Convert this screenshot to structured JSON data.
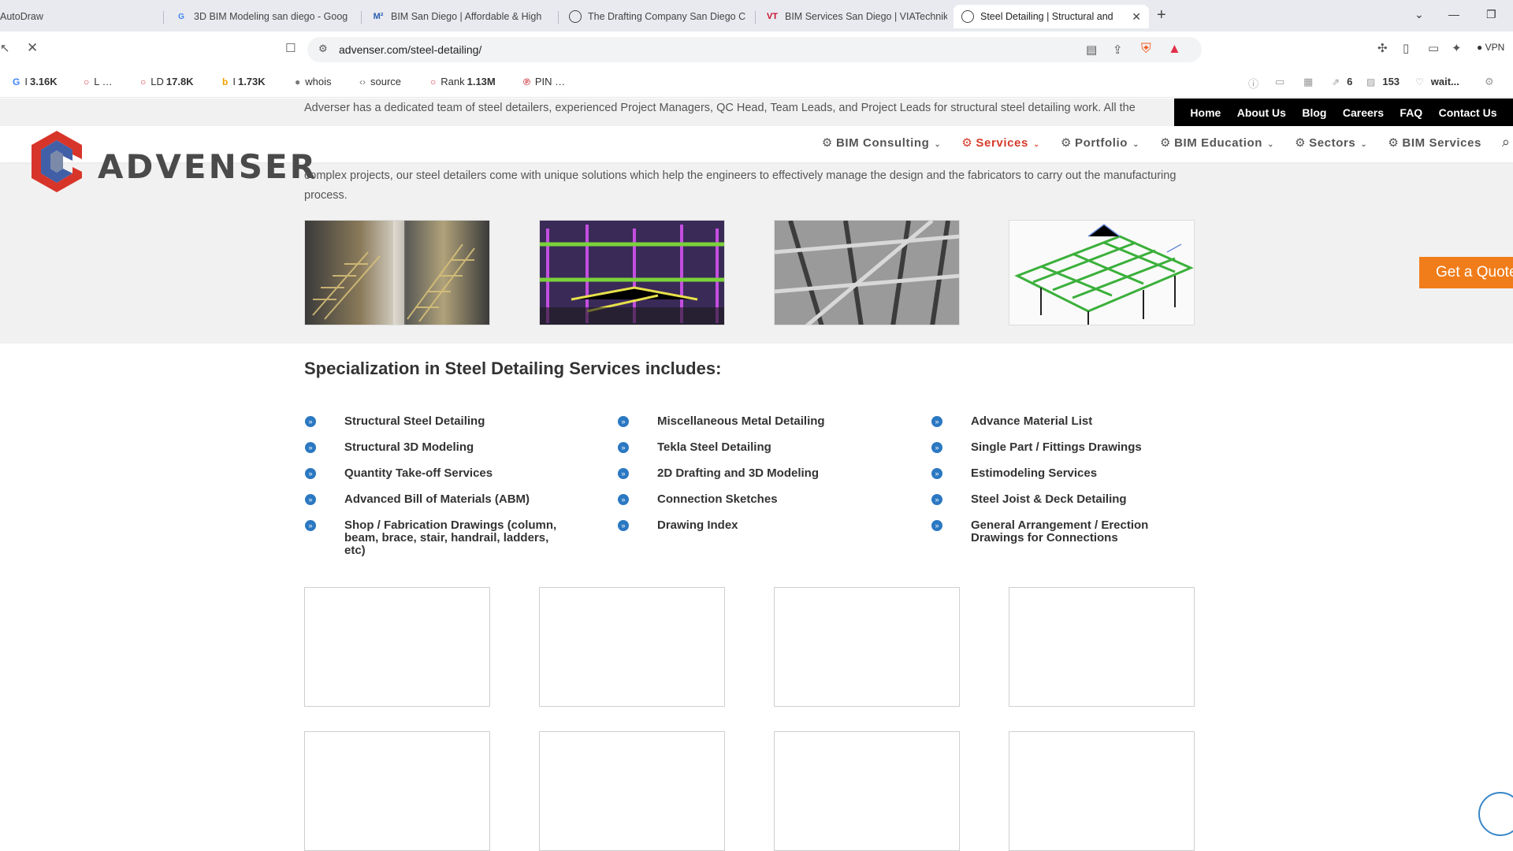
{
  "tabs": [
    {
      "title": "AutoDraw",
      "active": false
    },
    {
      "title": "3D BIM Modeling san diego - Goog",
      "active": false,
      "icon": "G"
    },
    {
      "title": "BIM San Diego | Affordable & High",
      "active": false,
      "icon": "M²"
    },
    {
      "title": "The Drafting Company San Diego C",
      "active": false,
      "icon": "globe"
    },
    {
      "title": "BIM Services San Diego | VIATechnik",
      "active": false,
      "icon": "VT"
    },
    {
      "title": "Steel Detailing | Structural and",
      "active": true,
      "icon": "globe"
    }
  ],
  "address": {
    "url": "advenser.com/steel-detailing/",
    "vpn": "VPN"
  },
  "bookmarks": [
    {
      "icon": "G",
      "label": "I",
      "value": "3.16K"
    },
    {
      "icon": "circle",
      "label": "L …",
      "value": ""
    },
    {
      "icon": "circle",
      "label": "LD",
      "value": "17.8K"
    },
    {
      "icon": "b",
      "label": "I",
      "value": "1.73K"
    },
    {
      "icon": "person",
      "label": "whois",
      "value": ""
    },
    {
      "icon": "code",
      "label": "source",
      "value": ""
    },
    {
      "icon": "circle",
      "label": "Rank",
      "value": "1.13M"
    },
    {
      "icon": "pin",
      "label": "PIN …",
      "value": ""
    }
  ],
  "ext_stats": {
    "links": "6",
    "count": "153",
    "wait": "wait..."
  },
  "intro": {
    "line1": "Adverser has a dedicated team of steel detailers, experienced Project Managers, QC Head, Team Leads, and Project Leads for structural steel detailing work. All the",
    "line2": "complex projects, our steel detailers come with unique solutions which help the engineers to effectively manage the design and the fabricators to carry out the manufacturing",
    "line3": "process."
  },
  "topnav": [
    "Home",
    "About Us",
    "Blog",
    "Careers",
    "FAQ",
    "Contact Us"
  ],
  "logo": {
    "word": "ADVENSER"
  },
  "mainnav": [
    {
      "label": "BIM Consulting",
      "active": false
    },
    {
      "label": "Services",
      "active": true
    },
    {
      "label": "Portfolio",
      "active": false
    },
    {
      "label": "BIM Education",
      "active": false
    },
    {
      "label": "Sectors",
      "active": false
    },
    {
      "label": "BIM Services",
      "active": false
    }
  ],
  "quote_button": "Get a Quote",
  "spec_title": "Specialization in Steel Detailing Services includes:",
  "columns": [
    [
      "Structural Steel Detailing",
      "Structural 3D Modeling",
      "Quantity Take-off Services",
      "Advanced Bill of Materials (ABM)",
      "Shop / Fabrication Drawings (column, beam, brace, stair, handrail, ladders, etc)"
    ],
    [
      "Miscellaneous Metal Detailing",
      "Tekla Steel Detailing",
      "2D Drafting and 3D Modeling",
      "Connection Sketches",
      "Drawing Index"
    ],
    [
      "Advance Material List",
      "Single Part / Fittings Drawings",
      "Estimodeling Services",
      "Steel Joist & Deck Detailing",
      "General Arrangement / Erection Drawings for Connections"
    ]
  ],
  "colors": {
    "accent": "#d53b2a",
    "bullet": "#2b78c2",
    "quote": "#f07d1a",
    "topnav_bg": "#000000"
  }
}
